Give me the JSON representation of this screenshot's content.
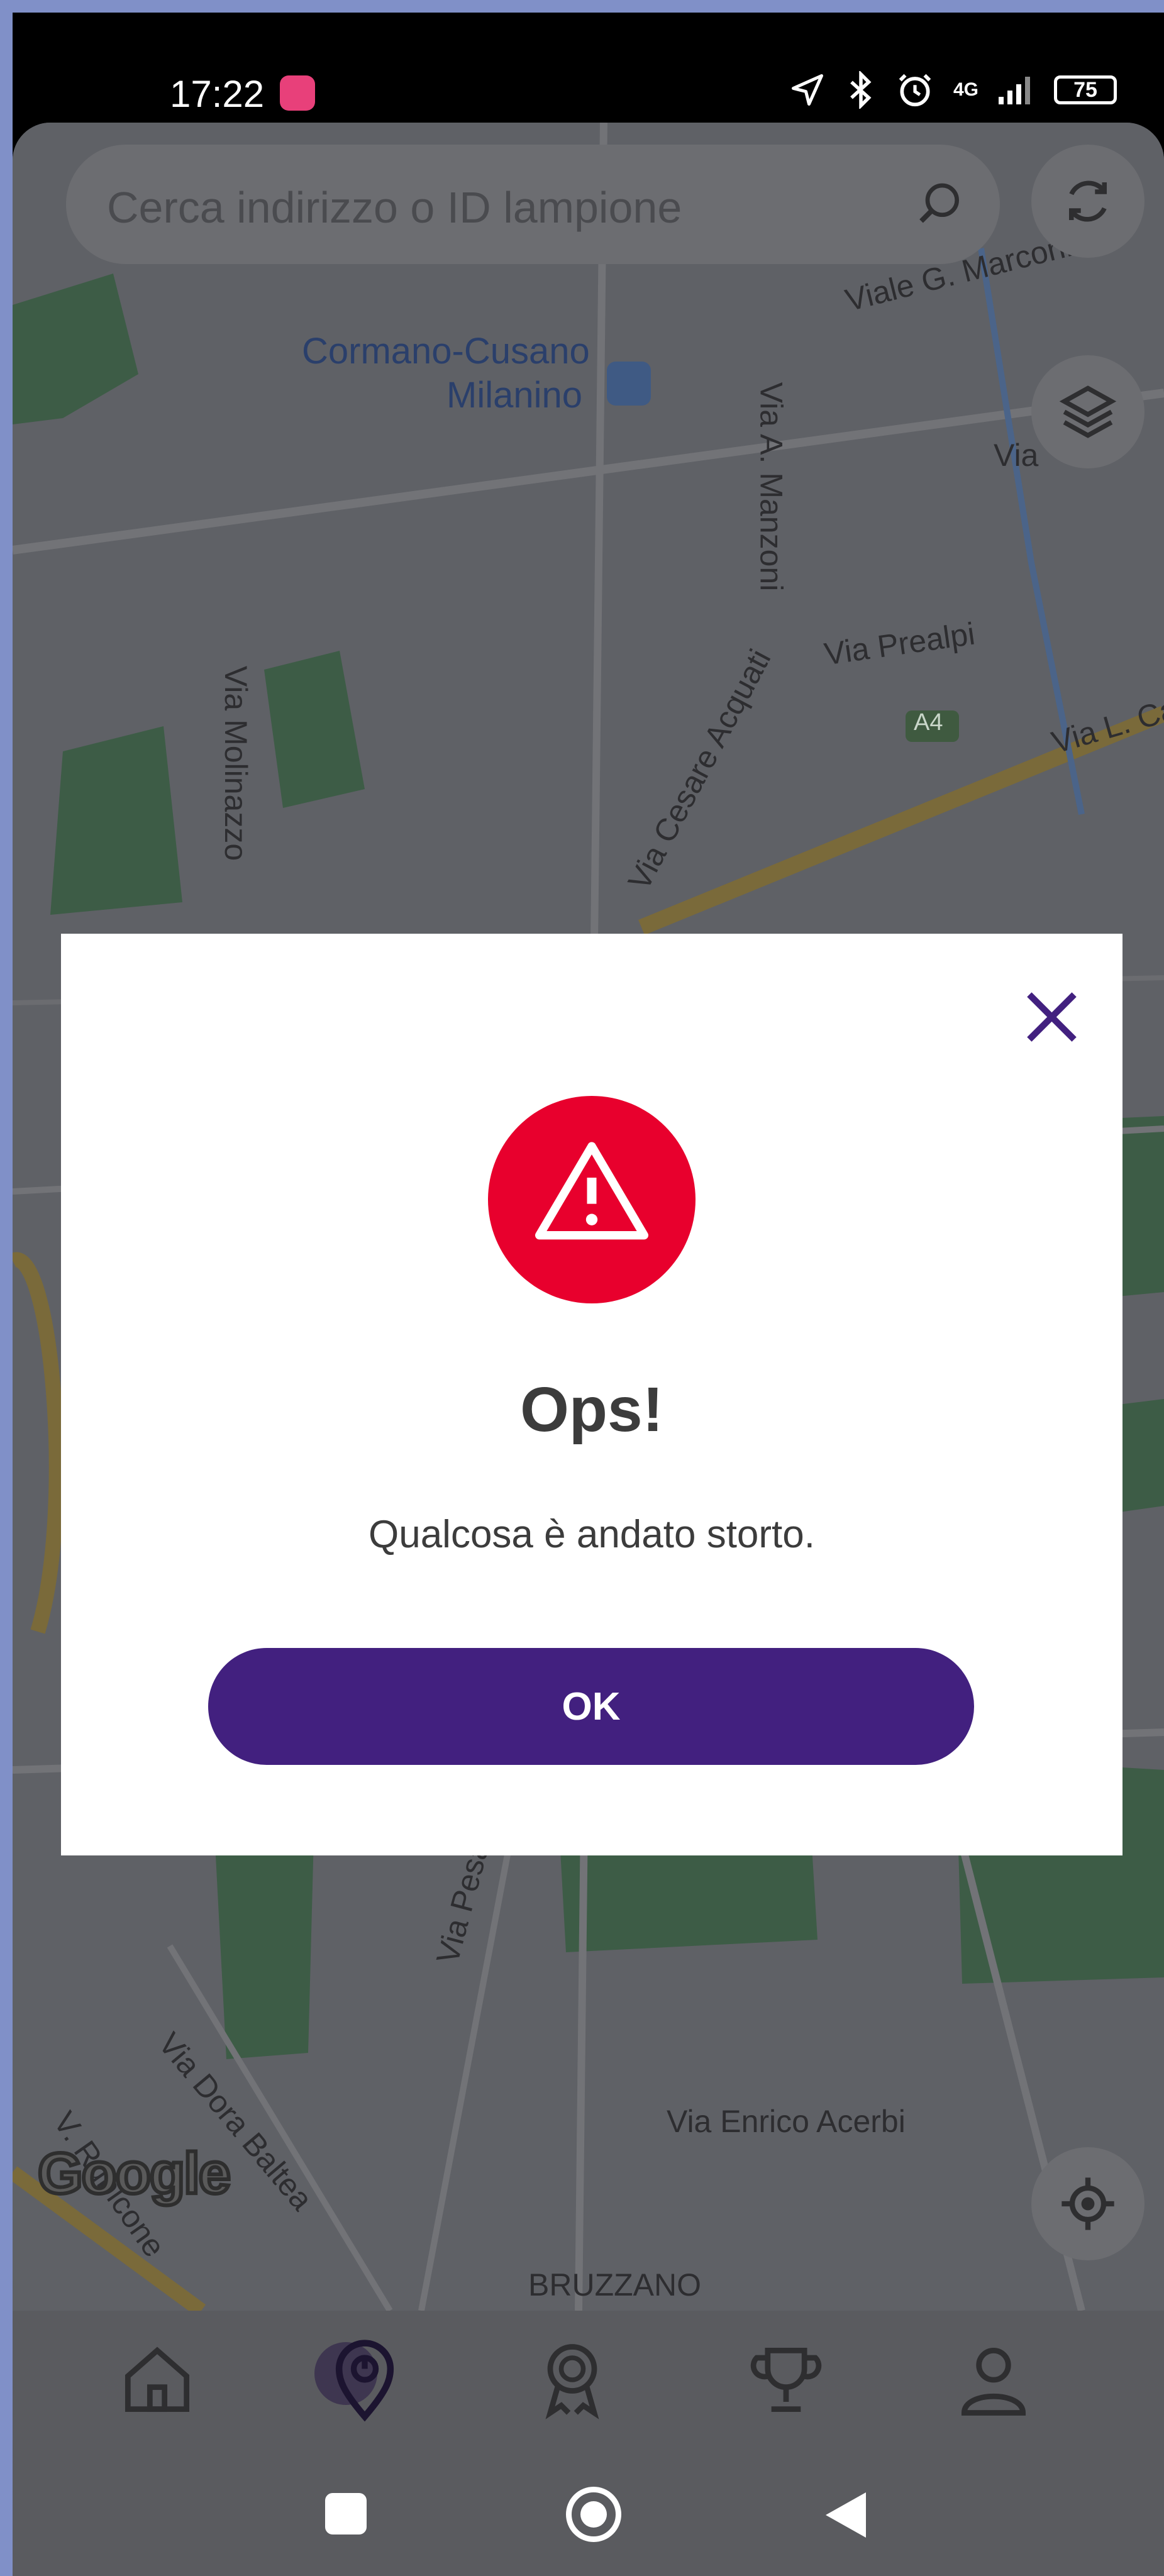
{
  "statusbar": {
    "time": "17:22",
    "network": "4G",
    "battery": "75",
    "icons": [
      "location-arrow-icon",
      "bluetooth-icon",
      "alarm-icon",
      "signal-icon",
      "battery-icon"
    ]
  },
  "search": {
    "placeholder": "Cerca indirizzo o ID lampione"
  },
  "map": {
    "labels": {
      "cormano": "Cormano-Cusano",
      "milanino": "Milanino",
      "viale_marconi": "Viale G. Marconi",
      "via_manzoni": "Via A. Manzoni",
      "via": "Via",
      "via_molinazzo": "Via Molinazzo",
      "via_cesare": "Via Cesare Acquati",
      "via_prealpi": "Via Prealpi",
      "a4": "A4",
      "via_lca": "Via L. Ca",
      "via_pesaro": "Via Pesaro",
      "via_dora": "Via Dora Baltea",
      "via_rubicone": "V. Rubicone",
      "via_acerbi": "Via Enrico Acerbi",
      "bruzzano": "BRUZZANO",
      "google": "Google"
    },
    "colors": {
      "park": "#3d5c46",
      "road": "#6e6f73",
      "highway": "#7a6a3a"
    }
  },
  "dialog": {
    "title": "Ops!",
    "message": "Qualcosa è andato storto.",
    "ok_label": "OK",
    "icon": "warning-icon",
    "colors": {
      "accent": "#42207f",
      "danger": "#e8002d"
    }
  },
  "bottom_nav": {
    "items": [
      "home-icon",
      "map-pin-icon",
      "award-icon",
      "trophy-icon",
      "profile-icon"
    ],
    "active": "map-pin-icon"
  },
  "system_nav": {
    "items": [
      "recents-button",
      "home-button",
      "back-button"
    ]
  }
}
